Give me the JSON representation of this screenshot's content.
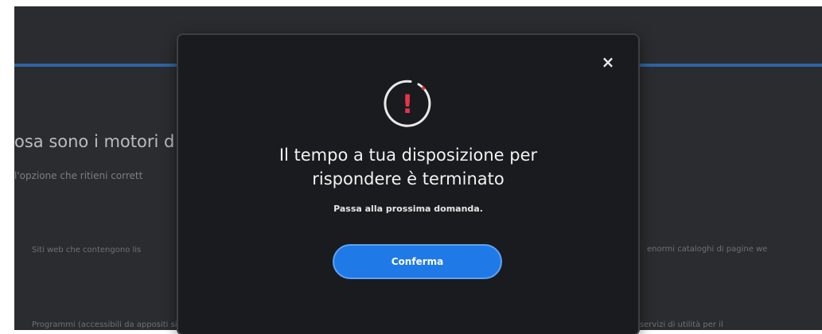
{
  "background": {
    "question_title": "osa sono i motori d",
    "question_hint": "l'opzione che ritieni corrett",
    "options": [
      "Siti web che contengono lis",
      "enormi cataloghi di pagine we",
      "Programmi (accessibili da appositi siti web) per individuare",
      "Siti web che forniscono numerosi servizi di utilità per il"
    ]
  },
  "modal": {
    "close_glyph": "×",
    "icon_glyph": "!",
    "title_line1": "Il tempo a tua disposizione per",
    "title_line2": "rispondere è terminato",
    "text": "Passa alla prossima domanda.",
    "confirm_label": "Conferma"
  },
  "colors": {
    "accent": "#1f7ae8",
    "alert": "#e8354a",
    "modal_bg": "#1a1b1e"
  }
}
